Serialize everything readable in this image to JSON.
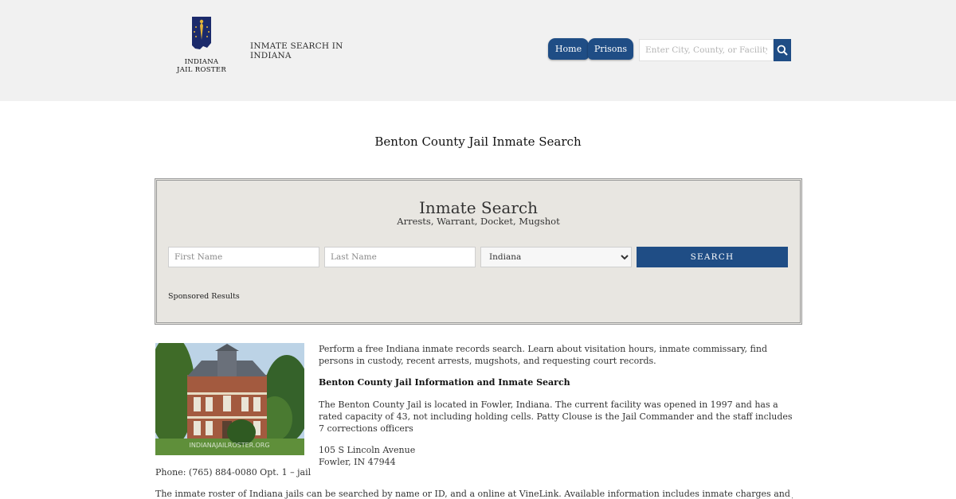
{
  "header": {
    "logo_line1": "INDIANA",
    "logo_line2": "JAIL ROSTER",
    "site_title": "INMATE SEARCH IN INDIANA",
    "nav": {
      "home": "Home",
      "prisons": "Prisons"
    },
    "search_placeholder": "Enter City, County, or Facility"
  },
  "page_title": "Benton County Jail Inmate Search",
  "search_panel": {
    "title": "Inmate Search",
    "subtitle": "Arrests, Warrant, Docket, Mugshot",
    "first_name_placeholder": "First Name",
    "last_name_placeholder": "Last Name",
    "state_selected": "Indiana",
    "search_label": "SEARCH",
    "sponsored": "Sponsored Results"
  },
  "content": {
    "intro": "Perform a free Indiana inmate records search. Learn about visitation hours, inmate commissary, find persons in custody, recent arrests, mugshots, and requesting court records.",
    "heading": "Benton County Jail Information and Inmate Search",
    "description": "The Benton County Jail is located in Fowler, Indiana. The current facility was opened in 1997 and has a rated capacity of 43, not including holding cells. Patty Clouse is the Jail Commander and the staff includes 7 corrections officers",
    "address_line1": "105 S Lincoln Avenue",
    "address_line2": "Fowler, IN 47944",
    "phone": "Phone: (765) 884-0080 Opt. 1 – jail",
    "truncated": "The inmate roster of Indiana jails can be searched by name or ID, and a online at VineLink. Available information includes inmate charges and jail status, booking"
  },
  "image": {
    "watermark": "INDIANAJAILROSTER.ORG"
  },
  "colors": {
    "accent": "#1f4d85",
    "header_bg": "#f1f1f1",
    "panel_bg": "#e8e6e1"
  }
}
